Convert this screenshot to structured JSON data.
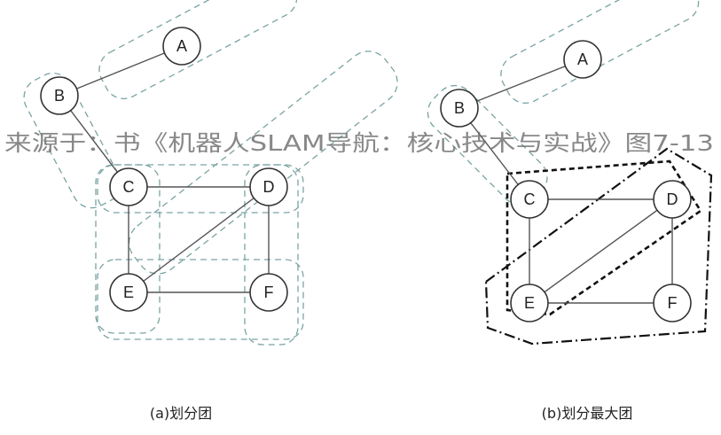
{
  "panels": [
    {
      "caption": "(a)划分团",
      "nodes": [
        "A",
        "B",
        "C",
        "D",
        "E",
        "F"
      ],
      "edges": [
        [
          "A",
          "B"
        ],
        [
          "B",
          "C"
        ],
        [
          "C",
          "D"
        ],
        [
          "C",
          "E"
        ],
        [
          "D",
          "E"
        ],
        [
          "D",
          "F"
        ],
        [
          "E",
          "F"
        ]
      ]
    },
    {
      "caption": "(b)划分最大团",
      "nodes": [
        "A",
        "B",
        "C",
        "D",
        "E",
        "F"
      ],
      "edges": [
        [
          "A",
          "B"
        ],
        [
          "B",
          "C"
        ],
        [
          "C",
          "D"
        ],
        [
          "C",
          "E"
        ],
        [
          "D",
          "E"
        ],
        [
          "D",
          "F"
        ],
        [
          "E",
          "F"
        ]
      ]
    }
  ],
  "watermark": "来源于：书《机器人SLAM导航：核心技术与实战》图7-13",
  "colors": {
    "clique_outline": "#7aa3a3",
    "max_clique_outline": "#111111",
    "node_stroke": "#333333"
  }
}
